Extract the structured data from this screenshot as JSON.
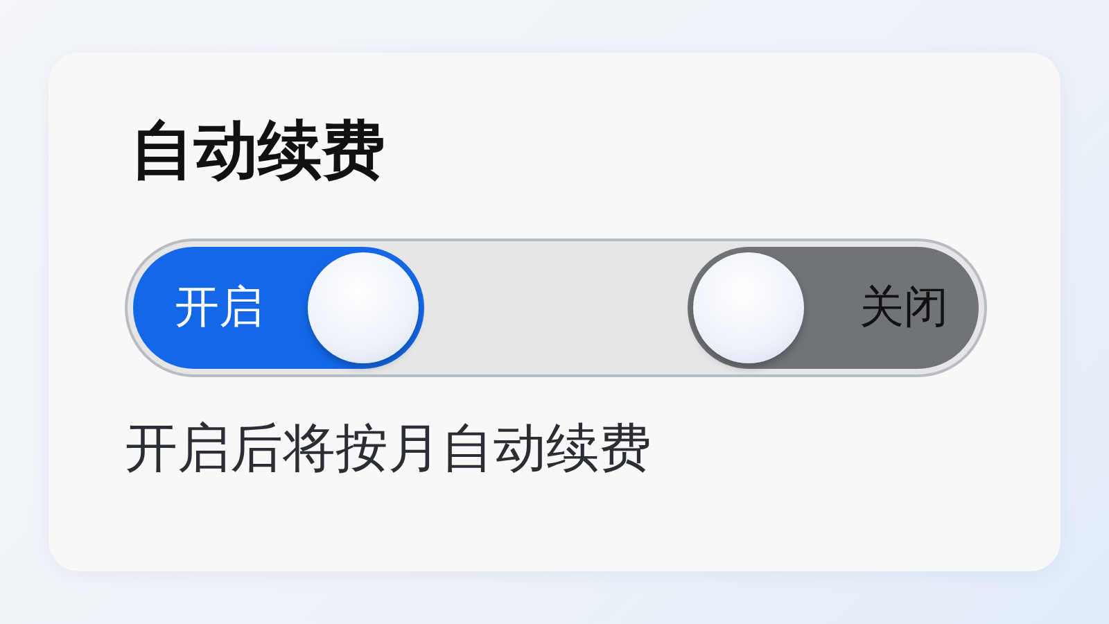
{
  "card": {
    "title": "自动续费",
    "options": [
      {
        "label": "开启",
        "selected": true
      },
      {
        "label": "关闭",
        "selected": false
      }
    ],
    "description": "开启后将按月自动续费"
  }
}
